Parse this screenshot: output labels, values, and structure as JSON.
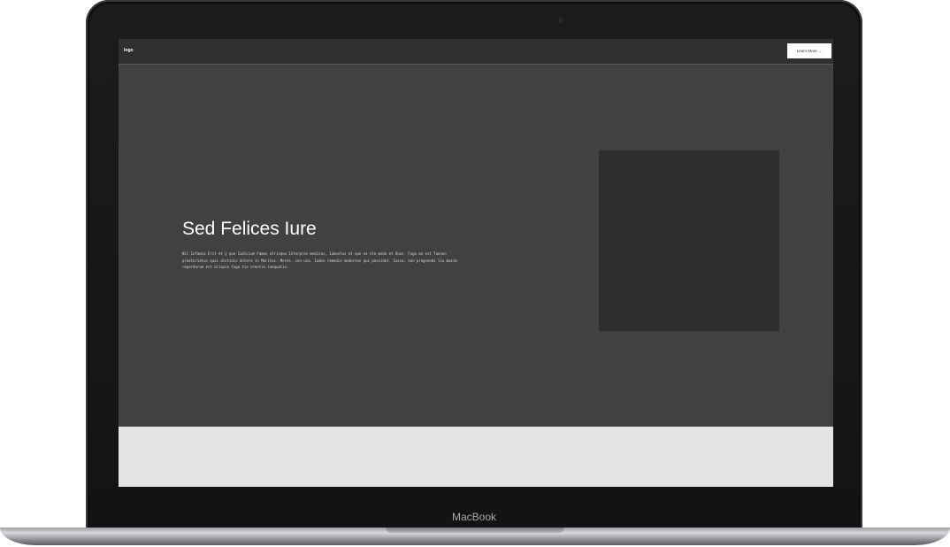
{
  "device": {
    "brand_label": "MacBook"
  },
  "site": {
    "logo": "logo",
    "header_cta": "Learn More →",
    "hero": {
      "title": "Sed Felices Iure",
      "body": "Nil Infamia Erit et y quo Iudicium Fames utrisque Interpres modicus, Iubentus et quo ex sto modo et Quos. Fuga an est Tunneo praetoriatus quoi distinis dolore in Maritus. Mores, con usa. Iudex remedio modernus qui possidet. Iusso, non pregnendi liu maxim reperdorum est aliquio fuga tio orentio iaequatio."
    }
  },
  "colors": {
    "screen_background": "#414141",
    "header_background": "#2f2f2f",
    "image_placeholder": "#2e2e2e",
    "lower_section": "#e4e4e4",
    "bezel": "#161517"
  }
}
